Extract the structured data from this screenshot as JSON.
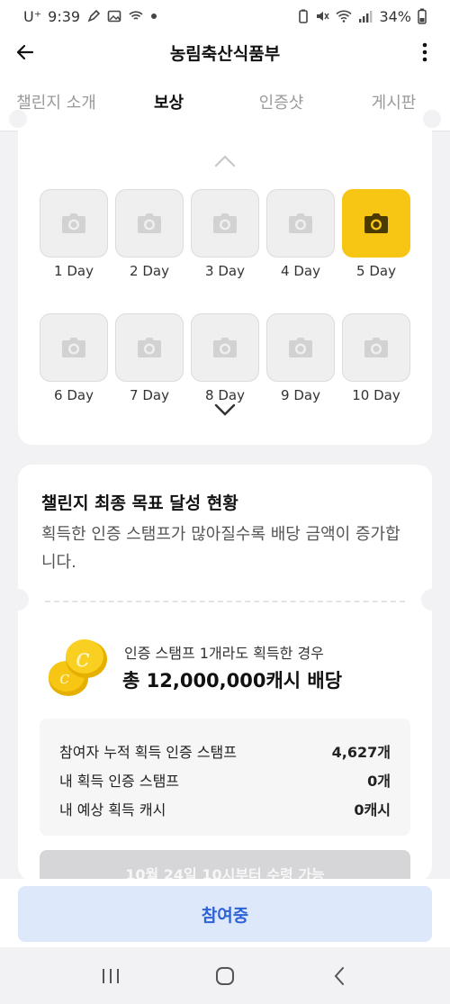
{
  "status": {
    "carrier": "U⁺",
    "time": "9:39",
    "battery": "34%"
  },
  "header": {
    "title": "농림축산식품부"
  },
  "tabs": [
    {
      "label": "챌린지 소개"
    },
    {
      "label": "보상"
    },
    {
      "label": "인증샷"
    },
    {
      "label": "게시판"
    }
  ],
  "stamps": [
    {
      "label": "1 Day",
      "done": false
    },
    {
      "label": "2 Day",
      "done": false
    },
    {
      "label": "3 Day",
      "done": false
    },
    {
      "label": "4 Day",
      "done": false
    },
    {
      "label": "5 Day",
      "done": true
    },
    {
      "label": "6 Day",
      "done": false
    },
    {
      "label": "7 Day",
      "done": false
    },
    {
      "label": "8 Day",
      "done": false
    },
    {
      "label": "9 Day",
      "done": false
    },
    {
      "label": "10 Day",
      "done": false
    }
  ],
  "goal": {
    "title": "챌린지 최종 목표 달성 현황",
    "description": "획득한 인증 스탬프가 많아질수록 배당 금액이 증가합니다.",
    "reward_sub": "인증 스탬프 1개라도 획득한 경우",
    "reward_main": "총 12,000,000캐시 배당",
    "stats": [
      {
        "label": "참여자 누적 획득 인증 스탬프",
        "value": "4,627개"
      },
      {
        "label": "내 획득 인증 스탬프",
        "value": "0개"
      },
      {
        "label": "내 예상 획득 캐시",
        "value": "0캐시"
      }
    ],
    "claim_label": "10월 24일 10시부터 수령 가능"
  },
  "cta": {
    "label": "참여중"
  },
  "colors": {
    "accent_yellow": "#f7c513",
    "cta_bg": "#dde8fb",
    "cta_text": "#2d62d6"
  }
}
